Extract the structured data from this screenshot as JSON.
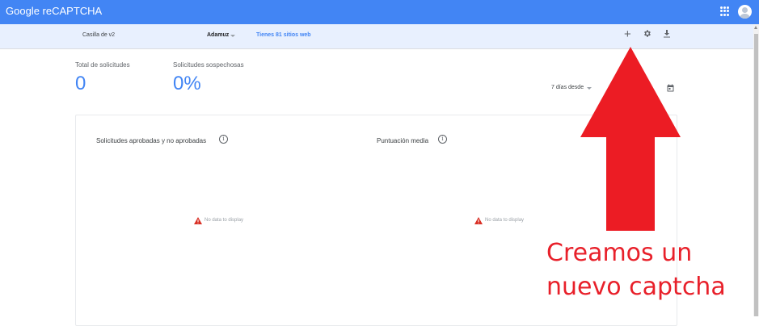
{
  "app": {
    "title": "Google reCAPTCHA"
  },
  "header": {
    "apps_icon": "apps-grid-icon",
    "avatar_icon": "account-avatar"
  },
  "subbar": {
    "site_name": "Casilla de v2",
    "owner": "Adamuz",
    "sites_link": "Tienes 81 sitios web",
    "add_icon": "+",
    "settings_icon": "gear-icon",
    "download_icon": "download-icon"
  },
  "stats": {
    "total_label": "Total de solicitudes",
    "total_value": "0",
    "suspicious_label": "Solicitudes sospechosas",
    "suspicious_value": "0%"
  },
  "range": {
    "label": "7 días desde",
    "calendar_icon": "calendar-icon"
  },
  "charts": {
    "left_title": "Solicitudes aprobadas y no aprobadas",
    "right_title": "Puntuación media",
    "info_glyph": "i",
    "empty_text": "No data to display"
  },
  "annotation": {
    "line1": "Creamos un",
    "line2": "nuevo captcha",
    "color": "#e8202a"
  },
  "colors": {
    "brand": "#4285f4",
    "subbar": "#e8f0fe",
    "warning": "#d93025"
  }
}
